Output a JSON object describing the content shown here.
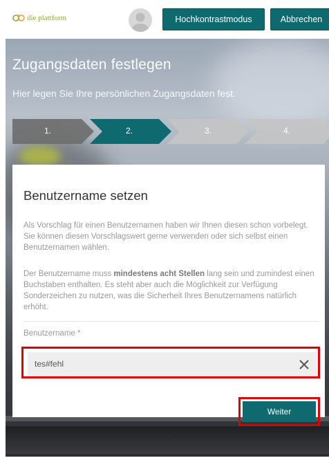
{
  "header": {
    "logo_text": "die plattform",
    "contrast_button": "Hochkontrastmodus",
    "cancel_button": "Abbrechen"
  },
  "hero": {
    "title": "Zugangsdaten festlegen",
    "subtitle": "Hier legen Sie Ihre persönlichen Zugangsdaten fest."
  },
  "steps": [
    {
      "label": "1.",
      "state": "done",
      "color": "#6e6e6e"
    },
    {
      "label": "2.",
      "state": "active",
      "color": "#0e6a6e"
    },
    {
      "label": "3.",
      "state": "pending",
      "color": "#bdbdbd"
    },
    {
      "label": "4.",
      "state": "pending",
      "color": "#bdbdbd"
    }
  ],
  "card": {
    "title": "Benutzername setzen",
    "paragraph1": "Als Vorschlag für einen Benutzernamen haben wir Ihnen diesen schon vorbelegt. Sie können diesen Vorschlagswert gerne verwenden oder sich selbst einen Benutzernamen wählen.",
    "paragraph2_before": "Der Benutzername muss ",
    "paragraph2_bold": "mindestens acht Stellen",
    "paragraph2_after": " lang sein und zumindest einen Buchstaben enthalten. Es steht aber auch die Möglichkeit zur Verfügung Sonderzeichen zu nutzen, was die Sicherheit Ihres Benutzernamens natürlich erhöht.",
    "field_label": "Benutzername *",
    "field_value": "tes#fehl",
    "clear_icon": "close-icon",
    "submit_button": "Weiter"
  },
  "colors": {
    "accent": "#0e6a6e",
    "highlight": "#e10000",
    "logo": "#8faa3a"
  }
}
